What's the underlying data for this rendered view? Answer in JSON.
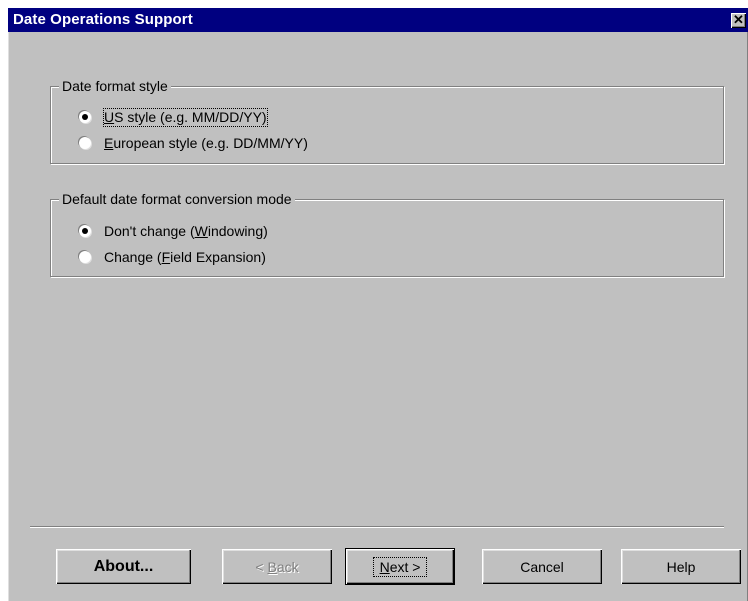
{
  "window": {
    "title": "Date Operations Support",
    "close_glyph": "✕"
  },
  "format_group": {
    "legend": "Date format style",
    "options": [
      {
        "label_pre": "",
        "label_ul": "U",
        "label_post": "S style (e.g. MM/DD/YY)",
        "selected": true
      },
      {
        "label_pre": "",
        "label_ul": "E",
        "label_post": "uropean style (e.g. DD/MM/YY)",
        "selected": false
      }
    ]
  },
  "mode_group": {
    "legend": "Default date format conversion mode",
    "options": [
      {
        "label_pre": "Don't change (",
        "label_ul": "W",
        "label_post": "indowing)",
        "selected": true
      },
      {
        "label_pre": "Change (",
        "label_ul": "F",
        "label_post": "ield Expansion)",
        "selected": false
      }
    ]
  },
  "buttons": {
    "about": "About...",
    "back_ul": "B",
    "back_pre": "< ",
    "back_post": "ack",
    "next_ul": "N",
    "next_post": "ext >",
    "cancel": "Cancel",
    "help": "Help"
  },
  "icons": {
    "close": "close-icon",
    "radio": "radio-button-icon"
  }
}
